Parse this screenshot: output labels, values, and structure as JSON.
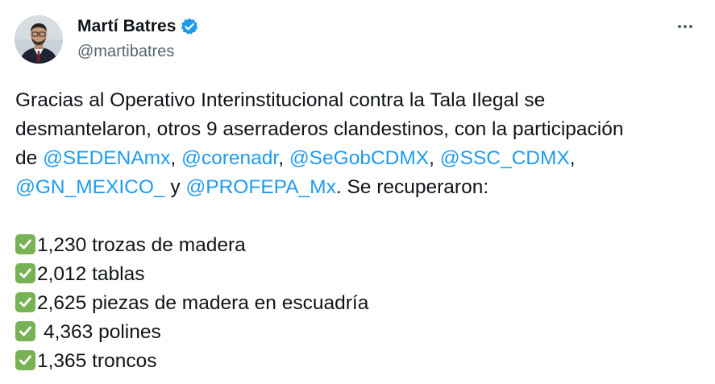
{
  "author": {
    "name": "Martí Batres",
    "handle": "@martibatres",
    "verified": true,
    "avatar": "profile-photo"
  },
  "menu": {
    "icon": "more-icon"
  },
  "tweet": {
    "line1": "Gracias al Operativo Interinstitucional contra la Tala Ilegal se",
    "line2": "desmantelaron, otros 9 aserraderos clandestinos, con la participación",
    "line3_prefix": "de ",
    "mentions": [
      "@SEDENAmx",
      "@corenadr",
      "@SeGobCDMX",
      "@SSC_CDMX",
      "@GN_MEXICO_",
      "@PROFEPA_Mx"
    ],
    "sep_comma": ", ",
    "sep_y": " y ",
    "line4_suffix": ". Se recuperaron:",
    "items": [
      "1,230 trozas de madera",
      "2,012 tablas",
      "2,625 piezas de madera en escuadría",
      "4,363 polines",
      "1,365 troncos"
    ],
    "check_icon": "check-mark-button-icon"
  },
  "colors": {
    "text": "#0f1419",
    "secondary": "#536471",
    "link": "#1d9bf0",
    "verified": "#1d9bf0",
    "check": "#77b255"
  }
}
